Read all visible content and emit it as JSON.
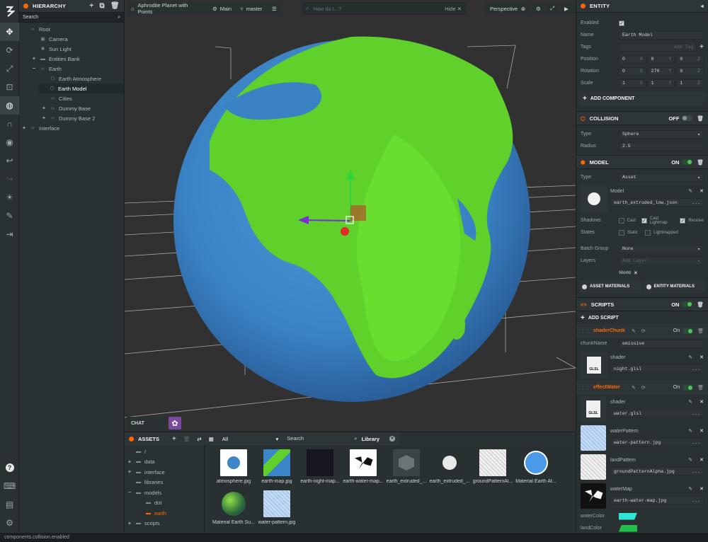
{
  "hierarchy": {
    "title": "HIERARCHY",
    "search_placeholder": "Search",
    "items": [
      {
        "label": "Root",
        "depth": 0,
        "toggle": "",
        "icon": "entity"
      },
      {
        "label": "Camera",
        "depth": 1,
        "toggle": "",
        "icon": "camera"
      },
      {
        "label": "Sun Light",
        "depth": 1,
        "toggle": "",
        "icon": "light"
      },
      {
        "label": "Entities Bank",
        "depth": 1,
        "toggle": "+",
        "icon": "folder"
      },
      {
        "label": "Earth",
        "depth": 1,
        "toggle": "−",
        "icon": "entity"
      },
      {
        "label": "Earth Atmosphere",
        "depth": 2,
        "toggle": "",
        "icon": "model"
      },
      {
        "label": "Earth Model",
        "depth": 2,
        "toggle": "",
        "icon": "model",
        "selected": true
      },
      {
        "label": "Cities",
        "depth": 2,
        "toggle": "",
        "icon": "entity"
      },
      {
        "label": "Dummy Base",
        "depth": 2,
        "toggle": "+",
        "icon": "entity"
      },
      {
        "label": "Dummy Base 2",
        "depth": 2,
        "toggle": "+",
        "icon": "entity"
      },
      {
        "label": "Interface",
        "depth": 0,
        "toggle": "+",
        "icon": "entity"
      }
    ]
  },
  "viewport": {
    "project": "Aphrodite Planet with Points",
    "scene": "Main",
    "branch": "master",
    "help_placeholder": "How do I...?",
    "hide_label": "Hide",
    "camera": "Perspective",
    "chat_label": "CHAT"
  },
  "inspector": {
    "title": "ENTITY",
    "enabled_label": "Enabled",
    "name_label": "Name",
    "name_value": "Earth Model",
    "tags_label": "Tags",
    "tags_placeholder": "Add Tag",
    "position_label": "Position",
    "position": [
      "0",
      "0",
      "0"
    ],
    "rotation_label": "Rotation",
    "rotation": [
      "0",
      "270",
      "0"
    ],
    "scale_label": "Scale",
    "scale": [
      "1",
      "1",
      "1"
    ],
    "axes": [
      "X",
      "Y",
      "Z"
    ],
    "add_component": "ADD COMPONENT",
    "collision": {
      "title": "COLLISION",
      "state": "OFF",
      "type_label": "Type",
      "type_value": "Sphere",
      "radius_label": "Radius",
      "radius_value": "2.5"
    },
    "model": {
      "title": "MODEL",
      "state": "ON",
      "type_label": "Type",
      "type_value": "Asset",
      "model_label": "Model",
      "model_value": "earth_extruded_low.json",
      "shadows_label": "Shadows",
      "cast": "Cast",
      "cast_lightmap": "Cast Lightmap",
      "receive": "Receive",
      "states_label": "States",
      "static": "Static",
      "lightmapped": "Lightmapped",
      "batch_label": "Batch Group",
      "batch_value": "None",
      "layers_label": "Layers",
      "layers_placeholder": "Add Layer",
      "layer_tag": "World",
      "asset_materials": "ASSET MATERIALS",
      "entity_materials": "ENTITY MATERIALS"
    },
    "scripts": {
      "title": "SCRIPTS",
      "state": "ON",
      "add_script": "ADD SCRIPT",
      "shader_chunk": {
        "name": "shaderChunk",
        "state": "On",
        "chunk_label": "chunkName",
        "chunk_value": "emissive",
        "shader_label": "shader",
        "shader_value": "night.glsl",
        "glsl": "GLSL"
      },
      "effect_water": {
        "name": "effectWater",
        "state": "On",
        "shader_label": "shader",
        "shader_value": "water.glsl",
        "glsl": "GLSL",
        "water_pattern_label": "waterPattern",
        "water_pattern_value": "water-pattern.jpg",
        "land_pattern_label": "landPattern",
        "land_pattern_value": "groundPatternAlpha.jpg",
        "water_map_label": "waterMap",
        "water_map_value": "earth-water-map.jpg",
        "water_color_label": "waterColor",
        "land_color_label": "landColor",
        "more": "..."
      }
    }
  },
  "assets": {
    "title": "ASSETS",
    "filter": "All",
    "search_placeholder": "Search",
    "library": "Library",
    "folders": [
      {
        "label": "/",
        "depth": 0,
        "toggle": ""
      },
      {
        "label": "data",
        "depth": 0,
        "toggle": "+"
      },
      {
        "label": "interface",
        "depth": 0,
        "toggle": "+"
      },
      {
        "label": "libraries",
        "depth": 0,
        "toggle": ""
      },
      {
        "label": "models",
        "depth": 0,
        "toggle": "−"
      },
      {
        "label": "dot",
        "depth": 1,
        "toggle": ""
      },
      {
        "label": "earth",
        "depth": 1,
        "toggle": "",
        "active": true
      },
      {
        "label": "scripts",
        "depth": 0,
        "toggle": "+"
      }
    ],
    "items": [
      {
        "label": "atmosphere.jpg"
      },
      {
        "label": "earth-map.jpg"
      },
      {
        "label": "earth-night-map..."
      },
      {
        "label": "earth-water-map..."
      },
      {
        "label": "earth_extruded_..."
      },
      {
        "label": "earth_extruded_..."
      },
      {
        "label": "groundPatternAl..."
      },
      {
        "label": "Material Earth At..."
      },
      {
        "label": "Material Earth Su..."
      },
      {
        "label": "water-pattern.jpg"
      }
    ]
  },
  "status": "components.collision.enabled",
  "colors": {
    "accent": "#ff6600",
    "water_color": "#2ee6d6",
    "land_color": "#22c04a",
    "ocean": "#3a86c8",
    "land": "#5fd12a"
  }
}
